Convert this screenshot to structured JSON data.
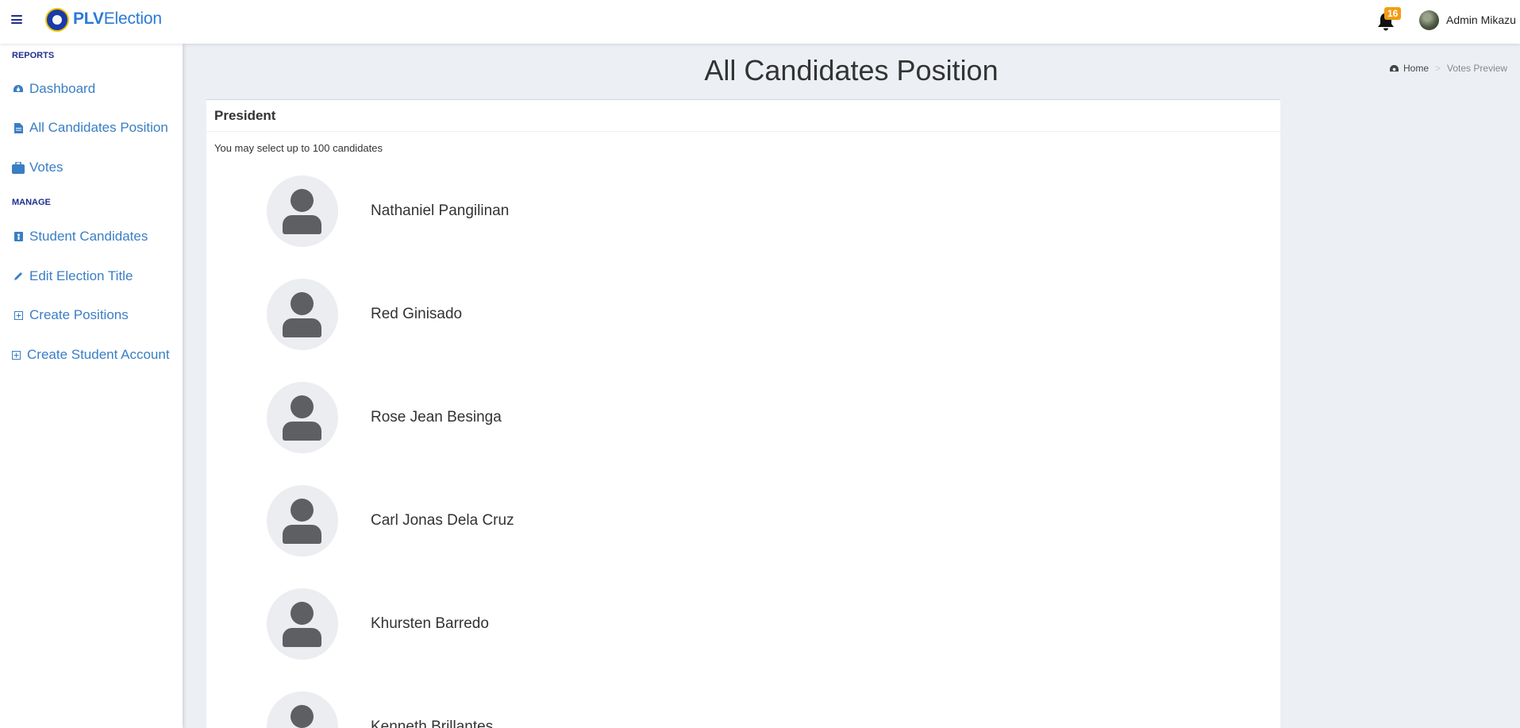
{
  "app": {
    "brand_bold": "PLV",
    "brand_rest": "Election",
    "notification_count": "16",
    "user_name": "Admin Mikazu"
  },
  "sidebar": {
    "reports_header": "REPORTS",
    "reports_items": [
      {
        "label": "Dashboard",
        "icon": "dashboard-icon"
      },
      {
        "label": "All Candidates Position",
        "icon": "file-icon"
      },
      {
        "label": "Votes",
        "icon": "briefcase-icon"
      }
    ],
    "manage_header": "MANAGE",
    "manage_items": [
      {
        "label": "Student Candidates",
        "icon": "id-badge-icon"
      },
      {
        "label": "Edit Election Title",
        "icon": "pencil-icon"
      },
      {
        "label": "Create Positions",
        "icon": "plus-square-icon"
      },
      {
        "label": "Create Student Account",
        "icon": "plus-square-icon"
      }
    ]
  },
  "main": {
    "page_title": "All Candidates Position",
    "breadcrumb": {
      "home": "Home",
      "current": "Votes Preview"
    },
    "position": {
      "title": "President",
      "note": "You may select up to 100 candidates",
      "candidates": [
        "Nathaniel Pangilinan",
        "Red Ginisado",
        "Rose Jean Besinga",
        "Carl Jonas Dela Cruz",
        "Khursten Barredo",
        "Kenneth Brillantes"
      ]
    }
  }
}
